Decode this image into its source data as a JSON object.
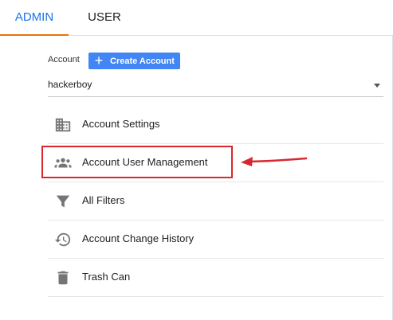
{
  "tabs": {
    "admin": "ADMIN",
    "user": "USER"
  },
  "account": {
    "label": "Account",
    "create_button": "Create Account",
    "selected": "hackerboy"
  },
  "menu": [
    {
      "label": "Account Settings",
      "icon": "building-icon"
    },
    {
      "label": "Account User Management",
      "icon": "people-icon"
    },
    {
      "label": "All Filters",
      "icon": "filter-icon"
    },
    {
      "label": "Account Change History",
      "icon": "history-icon"
    },
    {
      "label": "Trash Can",
      "icon": "trash-icon"
    }
  ],
  "colors": {
    "accent": "#1a73e8",
    "tab_underline": "#e8710a",
    "button": "#4285f4",
    "annotation": "#d7282f",
    "icon": "#757575"
  }
}
